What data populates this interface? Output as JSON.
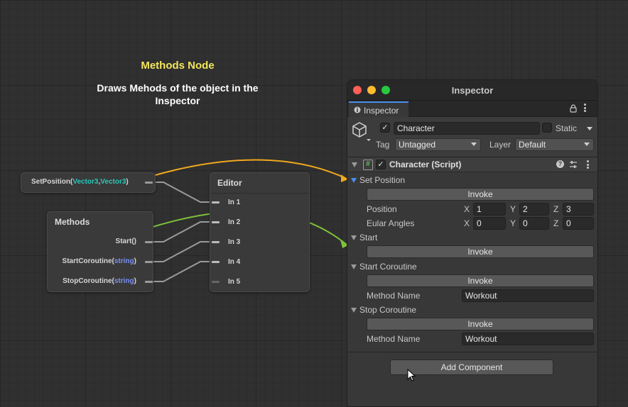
{
  "graph": {
    "title": "Methods Node",
    "subtitle_line1": "Draws Mehods of the object in the",
    "subtitle_line2": "Inspector",
    "setposition_node": {
      "name": "SetPosition",
      "open": "(",
      "arg1": "Vector3",
      "comma": ",",
      "arg2": "Vector3",
      "close": ")"
    },
    "methods_node": {
      "title": "Methods",
      "start": "Start()",
      "start_coroutine_name": "StartCoroutine(",
      "start_coroutine_arg": "string",
      "stop_coroutine_name": "StopCoroutine(",
      "stop_coroutine_arg": "string",
      "close": ")"
    },
    "editor_node": {
      "title": "Editor",
      "inputs": [
        "In 1",
        "In 2",
        "In 3",
        "In 4",
        "In 5"
      ]
    },
    "colors": {
      "link_orange": "#f0a81e",
      "link_green": "#7ec23a",
      "title_yellow": "#f4e65a",
      "type_vector": "#29c6b7",
      "type_string": "#7b8ff0"
    }
  },
  "inspector": {
    "window_title": "Inspector",
    "tab_label": "Inspector",
    "tab_icon": "info-icon",
    "object_name": "Character",
    "static_label": "Static",
    "tag_label": "Tag",
    "tag_value": "Untagged",
    "layer_label": "Layer",
    "layer_value": "Default",
    "component_title": "Character (Script)",
    "sections": {
      "set_position": {
        "title": "Set Position",
        "invoke": "Invoke",
        "position_label": "Position",
        "position": {
          "x": "1",
          "y": "2",
          "z": "3"
        },
        "euler_label": "Eular Angles",
        "euler": {
          "x": "0",
          "y": "0",
          "z": "0"
        }
      },
      "start": {
        "title": "Start",
        "invoke": "Invoke"
      },
      "start_coroutine": {
        "title": "Start Coroutine",
        "invoke": "Invoke",
        "method_label": "Method Name",
        "method_value": "Workout"
      },
      "stop_coroutine": {
        "title": "Stop Coroutine",
        "invoke": "Invoke",
        "method_label": "Method Name",
        "method_value": "Workout"
      }
    },
    "axis_labels": {
      "x": "X",
      "y": "Y",
      "z": "Z"
    },
    "add_component": "Add Component"
  }
}
